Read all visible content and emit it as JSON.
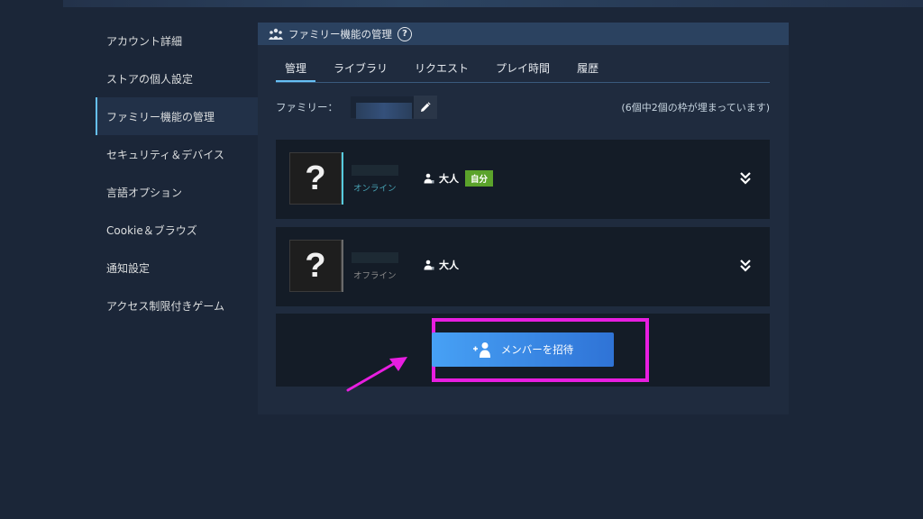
{
  "sidebar": {
    "items": [
      {
        "label": "アカウント詳細"
      },
      {
        "label": "ストアの個人設定"
      },
      {
        "label": "ファミリー機能の管理",
        "active": true
      },
      {
        "label": "セキュリティ＆デバイス"
      },
      {
        "label": "言語オプション"
      },
      {
        "label": "Cookie＆ブラウズ"
      },
      {
        "label": "通知設定"
      },
      {
        "label": "アクセス制限付きゲーム"
      }
    ]
  },
  "panel": {
    "title": "ファミリー機能の管理",
    "help": "?",
    "tabs": [
      {
        "label": "管理",
        "active": true
      },
      {
        "label": "ライブラリ"
      },
      {
        "label": "リクエスト"
      },
      {
        "label": "プレイ時間"
      },
      {
        "label": "履歴"
      }
    ],
    "family_label": "ファミリー：",
    "slots_text": "(6個中2個の枠が埋まっています)",
    "members": [
      {
        "avatar": "?",
        "status": "オンライン",
        "role": "大人",
        "badge": "自分"
      },
      {
        "avatar": "?",
        "status": "オフライン",
        "role": "大人"
      }
    ],
    "invite_label": "メンバーを招待"
  },
  "colors": {
    "accent": "#66c0f4",
    "badge_green": "#5ba32b",
    "highlight_magenta": "#e81ee0",
    "button_blue": "#2f73d6"
  },
  "icons": {
    "header": "family-icon",
    "edit": "pencil-icon",
    "role": "person-icon",
    "expand": "double-chevron-down-icon",
    "invite": "add-user-icon"
  }
}
